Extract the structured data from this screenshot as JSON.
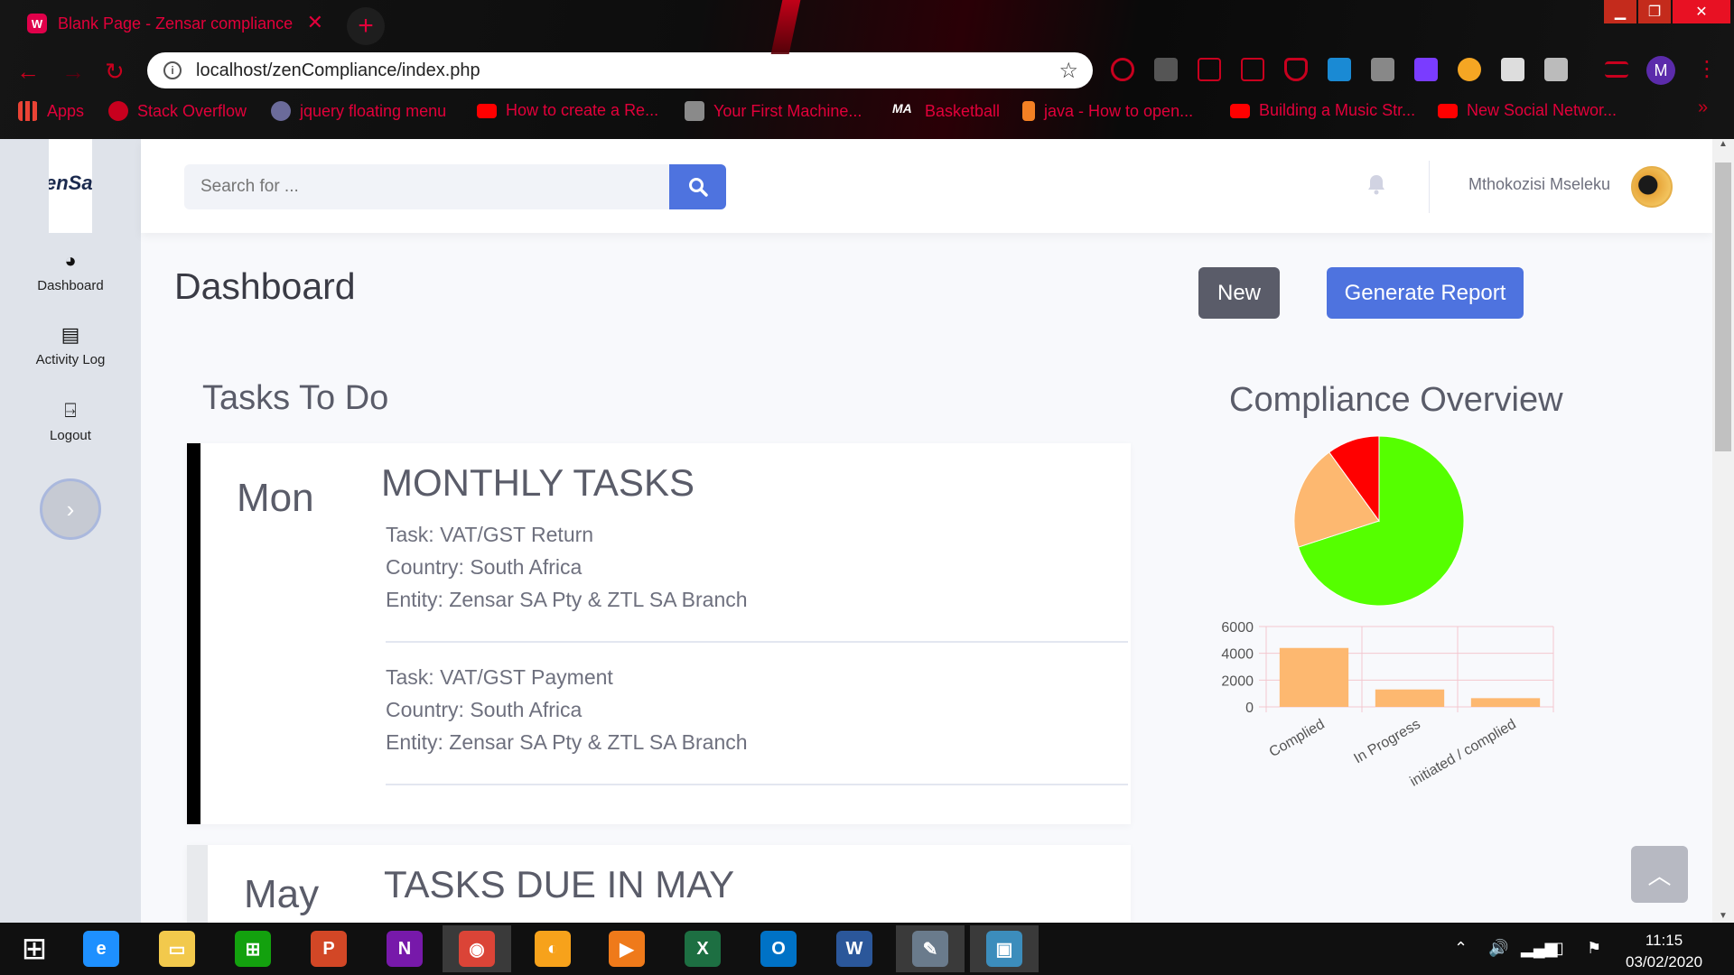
{
  "browser": {
    "tab_title": "Blank Page - Zensar compliance",
    "tab_favicon": "W",
    "url": "localhost/zenCompliance/index.php",
    "profile_initial": "M",
    "bookmarks": [
      {
        "label": "Apps",
        "icon": "apps-grid-icon",
        "color": "#f4b400"
      },
      {
        "label": "Stack Overflow",
        "icon": "stackoverflow-icon",
        "color": "#c8001e"
      },
      {
        "label": "jquery floating menu",
        "icon": "m-logo-icon",
        "color": "#6b6b9a"
      },
      {
        "label": "How to create a Re...",
        "icon": "youtube-icon",
        "color": "#ff0000"
      },
      {
        "label": "Your First Machine...",
        "icon": "page-icon",
        "color": "#8a8a8a"
      },
      {
        "label": "Basketball",
        "icon": "ma-logo-icon",
        "color": "#ffffff"
      },
      {
        "label": "java - How to open...",
        "icon": "stackoverflow-icon",
        "color": "#f48024"
      },
      {
        "label": "Building a Music Str...",
        "icon": "youtube-icon",
        "color": "#ff0000"
      },
      {
        "label": "New Social Networ...",
        "icon": "youtube-icon",
        "color": "#ff0000"
      }
    ]
  },
  "sidebar": {
    "logo_text": "enSa",
    "items": [
      {
        "label": "Dashboard",
        "icon": "tachometer-icon",
        "glyph": "◕"
      },
      {
        "label": "Activity Log",
        "icon": "book-icon",
        "glyph": "▤"
      },
      {
        "label": "Logout",
        "icon": "door-icon",
        "glyph": "⍈"
      }
    ],
    "toggle_glyph": "›"
  },
  "topbar": {
    "search_placeholder": "Search for ...",
    "user_name": "Mthokozisi Mseleku"
  },
  "page": {
    "title": "Dashboard",
    "btn_new": "New",
    "btn_report": "Generate Report",
    "tasks_title": "Tasks To Do",
    "compliance_title": "Compliance Overview"
  },
  "tasks": [
    {
      "day": "Mon",
      "heading": "MONTHLY TASKS",
      "items": [
        {
          "task": "Task: VAT/GST Return",
          "country": "Country: South Africa",
          "entity": "Entity: Zensar SA Pty & ZTL SA Branch"
        },
        {
          "task": "Task: VAT/GST Payment",
          "country": "Country: South Africa",
          "entity": "Entity: Zensar SA Pty & ZTL SA Branch"
        }
      ]
    },
    {
      "day": "May",
      "heading": "TASKS DUE IN MAY",
      "items": []
    }
  ],
  "chart_data": [
    {
      "type": "pie",
      "slices": [
        {
          "value": 70,
          "color": "#55ff00"
        },
        {
          "value": 20,
          "color": "#fdb870"
        },
        {
          "value": 10,
          "color": "#ff0000"
        }
      ]
    },
    {
      "type": "bar",
      "categories": [
        "Complied",
        "In Progress",
        "initiated / complied"
      ],
      "values": [
        4400,
        1300,
        650
      ],
      "ylim": [
        0,
        6000
      ],
      "yticks": [
        0,
        2000,
        4000,
        6000
      ],
      "bar_color": "#fdb870",
      "grid": true
    }
  ],
  "taskbar": {
    "apps": [
      {
        "name": "start-button",
        "glyph": "⊞",
        "color": "#101010"
      },
      {
        "name": "internet-explorer-icon",
        "glyph": "e",
        "color": "#1e90ff"
      },
      {
        "name": "file-explorer-icon",
        "glyph": "▭",
        "color": "#f2c94c"
      },
      {
        "name": "store-icon",
        "glyph": "⊞",
        "color": "#13a10e"
      },
      {
        "name": "powerpoint-icon",
        "glyph": "P",
        "color": "#d24726"
      },
      {
        "name": "onenote-icon",
        "glyph": "N",
        "color": "#7719aa"
      },
      {
        "name": "chrome-icon",
        "glyph": "◉",
        "color": "#db4437"
      },
      {
        "name": "fl-studio-icon",
        "glyph": "◐",
        "color": "#f7a21b"
      },
      {
        "name": "media-player-icon",
        "glyph": "▶",
        "color": "#ef7a1a"
      },
      {
        "name": "excel-icon",
        "glyph": "X",
        "color": "#1d6f42"
      },
      {
        "name": "outlook-icon",
        "glyph": "O",
        "color": "#0072c6"
      },
      {
        "name": "word-icon",
        "glyph": "W",
        "color": "#2b579a"
      },
      {
        "name": "paint-icon",
        "glyph": "✎",
        "color": "#6a7b8c"
      },
      {
        "name": "app-frame-icon",
        "glyph": "▣",
        "color": "#3c8dbc"
      }
    ],
    "time": "11:15",
    "date": "03/02/2020"
  }
}
